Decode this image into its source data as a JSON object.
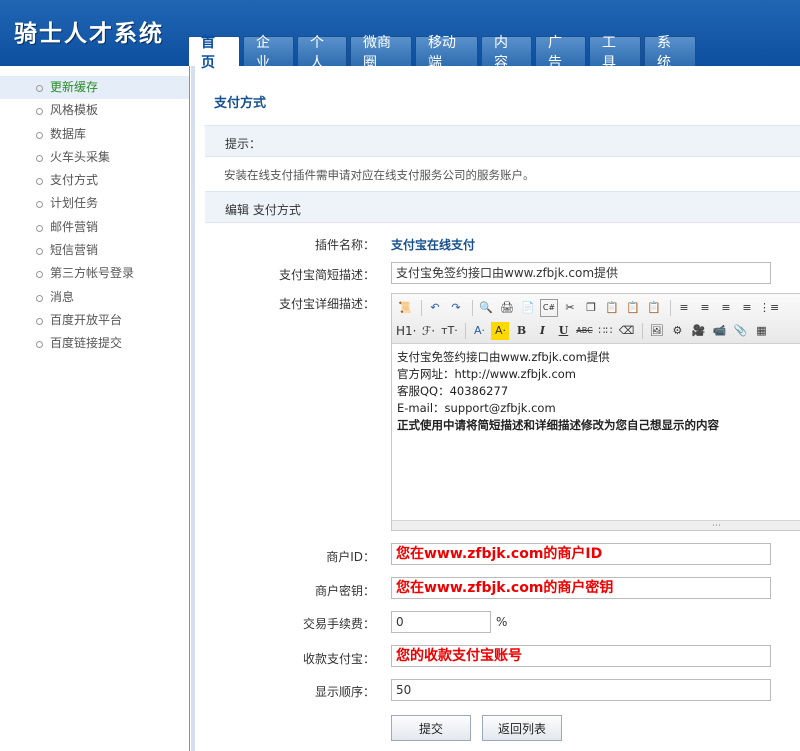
{
  "app": {
    "title": "骑士人才系统"
  },
  "nav": {
    "tabs": [
      {
        "label": "首页"
      },
      {
        "label": "企业"
      },
      {
        "label": "个人"
      },
      {
        "label": "微商圈"
      },
      {
        "label": "移动端"
      },
      {
        "label": "内容"
      },
      {
        "label": "广告"
      },
      {
        "label": "工具"
      },
      {
        "label": "系统"
      }
    ]
  },
  "sidebar": {
    "items": [
      {
        "label": "更新缓存"
      },
      {
        "label": "风格模板"
      },
      {
        "label": "数据库"
      },
      {
        "label": "火车头采集"
      },
      {
        "label": "支付方式"
      },
      {
        "label": "计划任务"
      },
      {
        "label": "邮件营销"
      },
      {
        "label": "短信营销"
      },
      {
        "label": "第三方帐号登录"
      },
      {
        "label": "消息"
      },
      {
        "label": "百度开放平台"
      },
      {
        "label": "百度链接提交"
      }
    ]
  },
  "page": {
    "title": "支付方式"
  },
  "tip": {
    "title": "提示：",
    "text": "安装在线支付插件需申请对应在线支付服务公司的服务账户。"
  },
  "edit": {
    "title": "编辑 支付方式"
  },
  "form": {
    "plugin_name_label": "插件名称：",
    "plugin_name_value": "支付宝在线支付",
    "short_desc_label": "支付宝简短描述：",
    "short_desc_value": "支付宝免签约接口由www.zfbjk.com提供",
    "detail_desc_label": "支付宝详细描述：",
    "detail_lines": [
      "支付宝免签约接口由www.zfbjk.com提供",
      "官方网址：http://www.zfbjk.com",
      "客服QQ：40386277",
      "E-mail：support@zfbjk.com",
      "正式使用中请将简短描述和详细描述修改为您自己想显示的内容"
    ],
    "merchant_id_label": "商户ID：",
    "merchant_id_value": "您在www.zfbjk.com的商户ID",
    "merchant_key_label": "商户密钥：",
    "merchant_key_value": "您在www.zfbjk.com的商户密钥",
    "fee_label": "交易手续费：",
    "fee_value": "0",
    "fee_unit": "%",
    "account_label": "收款支付宝：",
    "account_value": "您的收款支付宝账号",
    "order_label": "显示顺序：",
    "order_value": "50",
    "submit_label": "提交",
    "back_label": "返回列表"
  },
  "toolbar": {
    "h1": "H1·",
    "font": "ℱ·",
    "size": "ᴛT·",
    "forecolor": "A·",
    "bold": "B",
    "italic": "I",
    "underline": "U",
    "strike": "ABC"
  },
  "colors": {
    "header": "#1457a8",
    "accent": "#17518f",
    "red_text": "#ee0000",
    "sidebar_active": "#2a8a2a"
  }
}
